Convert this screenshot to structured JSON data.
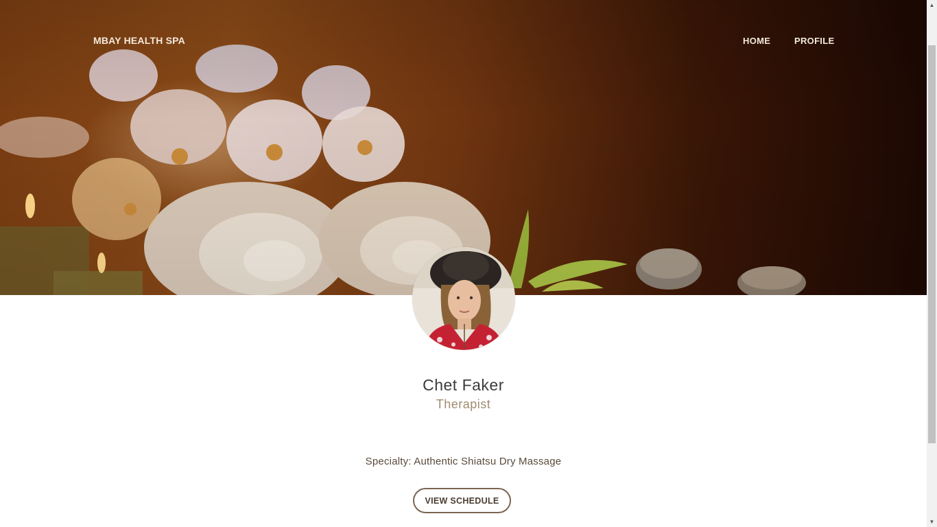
{
  "nav": {
    "brand": "MBAY HEALTH SPA",
    "links": [
      "HOME",
      "PROFILE"
    ]
  },
  "profile": {
    "name": "Chet Faker",
    "role": "Therapist",
    "specialty": "Specialty: Authentic Shiatsu Dry Massage",
    "button_label": "VIEW SCHEDULE"
  },
  "colors": {
    "accent": "#a08c71",
    "button_border": "#7a6450",
    "nav_text": "#f3e9dc"
  }
}
